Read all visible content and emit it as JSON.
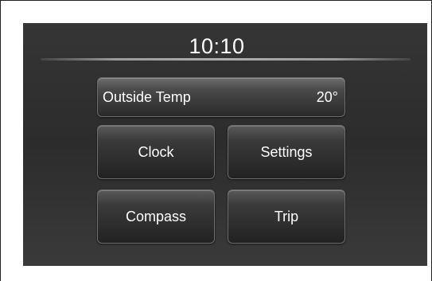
{
  "clock": {
    "time": "10:10"
  },
  "outside_temp": {
    "label": "Outside Temp",
    "value": "20°"
  },
  "menu": {
    "clock_label": "Clock",
    "settings_label": "Settings",
    "compass_label": "Compass",
    "trip_label": "Trip"
  },
  "colors": {
    "screen_background": "#2f2f2f",
    "button_border": "#6a6a6a",
    "text": "#ffffff"
  }
}
